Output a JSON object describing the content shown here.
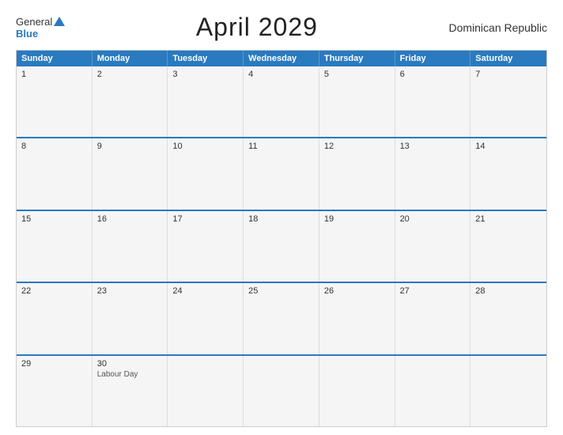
{
  "header": {
    "logo_general": "General",
    "logo_blue": "Blue",
    "title": "April 2029",
    "country": "Dominican Republic"
  },
  "calendar": {
    "days_of_week": [
      "Sunday",
      "Monday",
      "Tuesday",
      "Wednesday",
      "Thursday",
      "Friday",
      "Saturday"
    ],
    "weeks": [
      [
        {
          "day": "1",
          "event": ""
        },
        {
          "day": "2",
          "event": ""
        },
        {
          "day": "3",
          "event": ""
        },
        {
          "day": "4",
          "event": ""
        },
        {
          "day": "5",
          "event": ""
        },
        {
          "day": "6",
          "event": ""
        },
        {
          "day": "7",
          "event": ""
        }
      ],
      [
        {
          "day": "8",
          "event": ""
        },
        {
          "day": "9",
          "event": ""
        },
        {
          "day": "10",
          "event": ""
        },
        {
          "day": "11",
          "event": ""
        },
        {
          "day": "12",
          "event": ""
        },
        {
          "day": "13",
          "event": ""
        },
        {
          "day": "14",
          "event": ""
        }
      ],
      [
        {
          "day": "15",
          "event": ""
        },
        {
          "day": "16",
          "event": ""
        },
        {
          "day": "17",
          "event": ""
        },
        {
          "day": "18",
          "event": ""
        },
        {
          "day": "19",
          "event": ""
        },
        {
          "day": "20",
          "event": ""
        },
        {
          "day": "21",
          "event": ""
        }
      ],
      [
        {
          "day": "22",
          "event": ""
        },
        {
          "day": "23",
          "event": ""
        },
        {
          "day": "24",
          "event": ""
        },
        {
          "day": "25",
          "event": ""
        },
        {
          "day": "26",
          "event": ""
        },
        {
          "day": "27",
          "event": ""
        },
        {
          "day": "28",
          "event": ""
        }
      ],
      [
        {
          "day": "29",
          "event": ""
        },
        {
          "day": "30",
          "event": "Labour Day"
        },
        {
          "day": "",
          "event": ""
        },
        {
          "day": "",
          "event": ""
        },
        {
          "day": "",
          "event": ""
        },
        {
          "day": "",
          "event": ""
        },
        {
          "day": "",
          "event": ""
        }
      ]
    ]
  }
}
